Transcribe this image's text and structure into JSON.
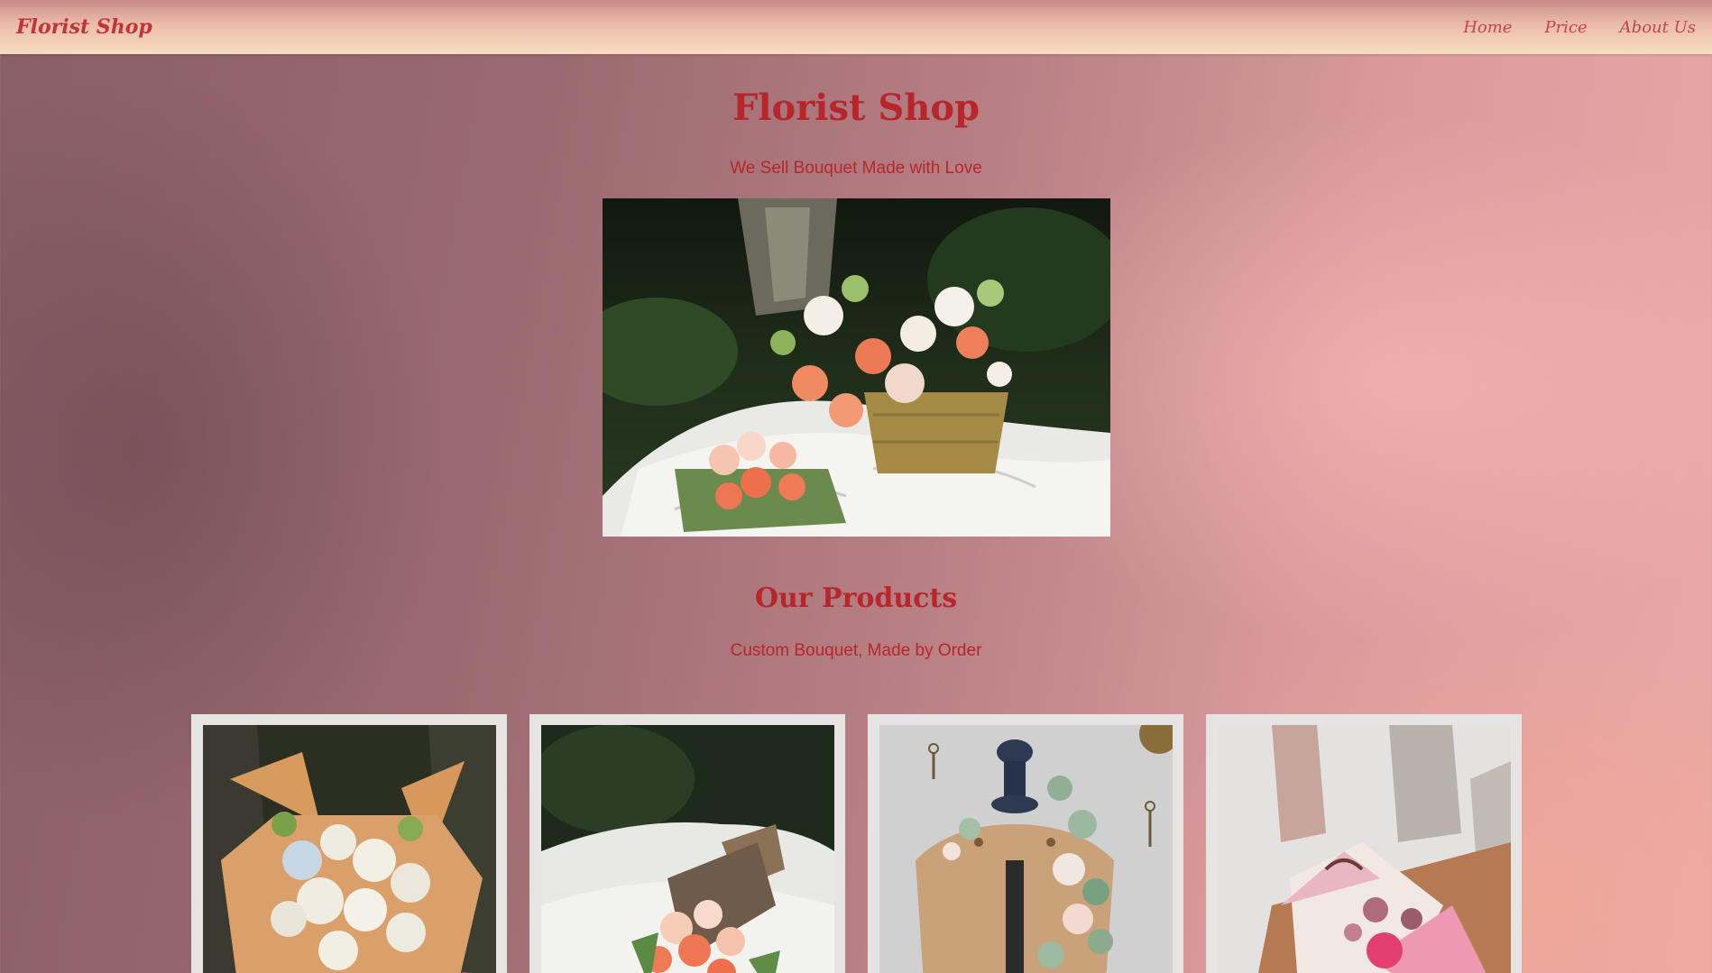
{
  "navbar": {
    "brand": "Florist Shop",
    "links": [
      "Home",
      "Price",
      "About Us"
    ]
  },
  "hero": {
    "title": "Florist Shop",
    "subtitle": "We Sell Bouquet Made with Love",
    "image_alt": "basket-of-flowers-photo"
  },
  "products": {
    "title": "Our Products",
    "subtitle": "Custom Bouquet, Made by Order",
    "items": [
      {
        "image": "white-rose-bouquet-photo"
      },
      {
        "image": "peach-carnation-bouquet-photo"
      },
      {
        "image": "mannequin-floral-photo"
      },
      {
        "image": "pink-rose-bouquet-photo"
      }
    ]
  },
  "colors": {
    "accent": "#b8262c",
    "navbar_top": "#c98a8a",
    "navbar_bottom": "#f7dcc0",
    "card_frame": "#e6e4e2"
  }
}
